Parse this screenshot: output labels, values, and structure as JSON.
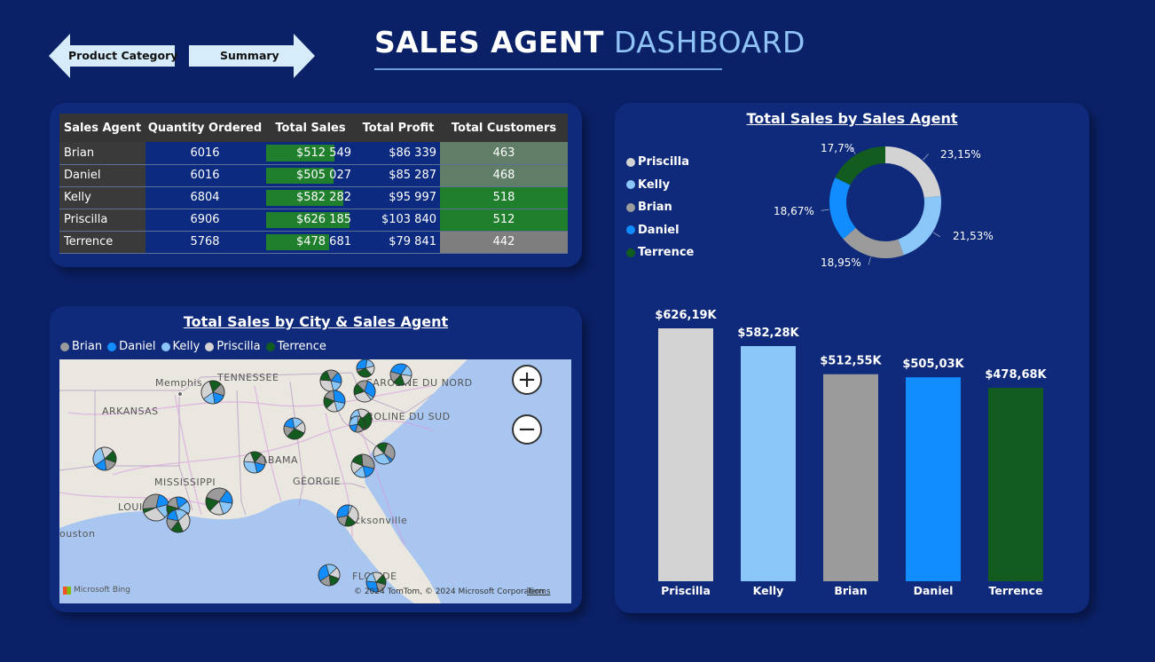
{
  "nav": {
    "back_label": "Product Category",
    "forward_label": "Summary"
  },
  "title": {
    "part1": "SALES AGENT",
    "part2": "DASHBOARD"
  },
  "table": {
    "headers": [
      "Sales Agent",
      "Quantity Ordered",
      "Total Sales",
      "Total Profit",
      "Total Customers"
    ],
    "rows": [
      {
        "agent": "Brian",
        "qty": "6016",
        "sales": "$512 549",
        "profit": "$86 339",
        "customers": "463",
        "sales_fill": 0.82,
        "cust_color": "#5f7d67"
      },
      {
        "agent": "Daniel",
        "qty": "6016",
        "sales": "$505 027",
        "profit": "$85 287",
        "customers": "468",
        "sales_fill": 0.81,
        "cust_color": "#5f7d67"
      },
      {
        "agent": "Kelly",
        "qty": "6804",
        "sales": "$582 282",
        "profit": "$95 997",
        "customers": "518",
        "sales_fill": 0.93,
        "cust_color": "#1f7f2d"
      },
      {
        "agent": "Priscilla",
        "qty": "6906",
        "sales": "$626 185",
        "profit": "$103 840",
        "customers": "512",
        "sales_fill": 1.0,
        "cust_color": "#1f7f2d"
      },
      {
        "agent": "Terrence",
        "qty": "5768",
        "sales": "$478 681",
        "profit": "$79 841",
        "customers": "442",
        "sales_fill": 0.76,
        "cust_color": "#7e7e7e"
      }
    ]
  },
  "map": {
    "title": "Total Sales by City & Sales Agent",
    "legend": [
      {
        "name": "Brian",
        "color": "#9b9b9b"
      },
      {
        "name": "Daniel",
        "color": "#118dff"
      },
      {
        "name": "Kelly",
        "color": "#8ac6f7"
      },
      {
        "name": "Priscilla",
        "color": "#d3d3d3"
      },
      {
        "name": "Terrence",
        "color": "#125c1f"
      }
    ],
    "labels": [
      "Memphis",
      "TENNESSEE",
      "ARKANSAS",
      "ALABAMA",
      "MISSISSIPPI",
      "GÉORGIE",
      "LOUISIANE",
      "Jacksonville",
      "ouston",
      "CAROLINE DU NORD",
      "CAROLINE DU SUD",
      "FLORIDE"
    ],
    "zoom_in": "+",
    "zoom_out": "−",
    "brand": "Microsoft Bing",
    "copyright": "© 2024 TomTom, © 2024 Microsoft Corporation",
    "terms": "Terms"
  },
  "donut": {
    "title": "Total Sales by Sales Agent",
    "legend": [
      {
        "name": "Priscilla",
        "color": "#d3d3d3"
      },
      {
        "name": "Kelly",
        "color": "#8ac6f7"
      },
      {
        "name": "Brian",
        "color": "#9b9b9b"
      },
      {
        "name": "Daniel",
        "color": "#118dff"
      },
      {
        "name": "Terrence",
        "color": "#125c1f"
      }
    ]
  },
  "chart_data": [
    {
      "type": "pie",
      "title": "Total Sales by Sales Agent",
      "categories": [
        "Priscilla",
        "Kelly",
        "Brian",
        "Daniel",
        "Terrence"
      ],
      "values": [
        23.15,
        21.53,
        18.95,
        18.67,
        17.7
      ],
      "labels": [
        "23,15%",
        "21,53%",
        "18,95%",
        "18,67%",
        "17,7%"
      ],
      "colors": [
        "#d3d3d3",
        "#8ac6f7",
        "#9b9b9b",
        "#118dff",
        "#125c1f"
      ],
      "legend": "left"
    },
    {
      "type": "bar",
      "categories": [
        "Priscilla",
        "Kelly",
        "Brian",
        "Daniel",
        "Terrence"
      ],
      "values": [
        626.19,
        582.28,
        512.55,
        505.03,
        478.68
      ],
      "labels": [
        "$626,19K",
        "$582,28K",
        "$512,55K",
        "$505,03K",
        "$478,68K"
      ],
      "colors": [
        "#d3d3d3",
        "#8ac6f7",
        "#9b9b9b",
        "#118dff",
        "#125c1f"
      ],
      "ylim": [
        0,
        626.19
      ]
    }
  ]
}
